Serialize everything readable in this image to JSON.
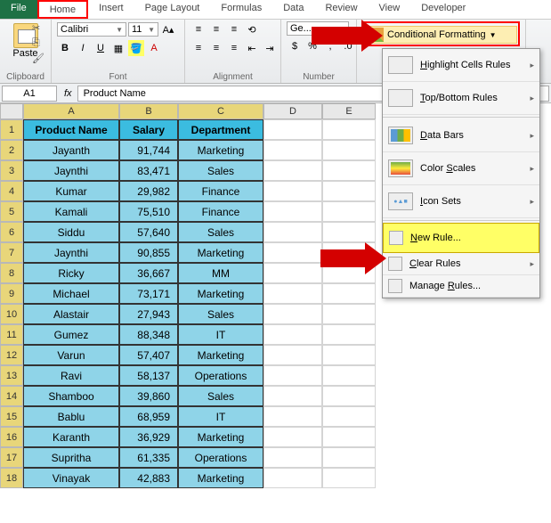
{
  "tabs": {
    "file": "File",
    "home": "Home",
    "insert": "Insert",
    "pageLayout": "Page Layout",
    "formulas": "Formulas",
    "data": "Data",
    "review": "Review",
    "view": "View",
    "developer": "Developer"
  },
  "ribbon": {
    "paste": "Paste",
    "clipboard": "Clipboard",
    "font": "Font",
    "alignment": "Alignment",
    "number": "Number",
    "fontName": "Calibri",
    "fontSize": "11",
    "condFmt": "Conditional Formatting",
    "general": "Ge..."
  },
  "nameBox": "A1",
  "fx": "fx",
  "formula": "Product Name",
  "cols": [
    "A",
    "B",
    "C",
    "D",
    "E"
  ],
  "rows": [
    "1",
    "2",
    "3",
    "4",
    "5",
    "6",
    "7",
    "8",
    "9",
    "10",
    "11",
    "12",
    "13",
    "14",
    "15",
    "16",
    "17",
    "18"
  ],
  "headers": [
    "Product Name",
    "Salary",
    "Department"
  ],
  "data": [
    [
      "Jayanth",
      "91,744",
      "Marketing"
    ],
    [
      "Jaynthi",
      "83,471",
      "Sales"
    ],
    [
      "Kumar",
      "29,982",
      "Finance"
    ],
    [
      "Kamali",
      "75,510",
      "Finance"
    ],
    [
      "Siddu",
      "57,640",
      "Sales"
    ],
    [
      "Jaynthi",
      "90,855",
      "Marketing"
    ],
    [
      "Ricky",
      "36,667",
      "MM"
    ],
    [
      "Michael",
      "73,171",
      "Marketing"
    ],
    [
      "Alastair",
      "27,943",
      "Sales"
    ],
    [
      "Gumez",
      "88,348",
      "IT"
    ],
    [
      "Varun",
      "57,407",
      "Marketing"
    ],
    [
      "Ravi",
      "58,137",
      "Operations"
    ],
    [
      "Shamboo",
      "39,860",
      "Sales"
    ],
    [
      "Bablu",
      "68,959",
      "IT"
    ],
    [
      "Karanth",
      "36,929",
      "Marketing"
    ],
    [
      "Supritha",
      "61,335",
      "Operations"
    ],
    [
      "Vinayak",
      "42,883",
      "Marketing"
    ]
  ],
  "dropdown": {
    "highlight": "Highlight Cells Rules",
    "topBottom": "Top/Bottom Rules",
    "dataBars": "Data Bars",
    "colorScales": "Color Scales",
    "iconSets": "Icon Sets",
    "newRule": "New Rule...",
    "clearRules": "Clear Rules",
    "manageRules": "Manage Rules..."
  }
}
